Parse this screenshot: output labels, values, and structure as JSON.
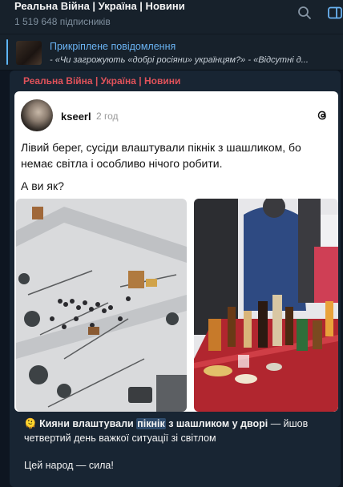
{
  "channel": {
    "title": "Реальна Війна | Україна | Новини",
    "subscribers": "1 519 648 підписників"
  },
  "header_icons": [
    "search-icon",
    "sidebar-toggle-icon"
  ],
  "pinned": {
    "title": "Прикріплене повідомлення",
    "text": "- «Чи загрожують «добрі росіяни» українцям?» - «Відсутні д..."
  },
  "message": {
    "author": "Реальна Війна | Україна | Новини",
    "embed": {
      "username": "kseerl",
      "time": "2 год",
      "text": "Лівий берег, сусіди влаштували пікнік з шашликом, бо немає світла і особливо нічого робити.",
      "question": "А ви як?"
    },
    "caption": {
      "emoji": "🫠",
      "bold_part1": "Кияни влаштували ",
      "highlight": "пікнік",
      "bold_part2": " з шашликом у дворі",
      "rest": " — йшов четвертий день важкої ситуації зі світлом",
      "line2": "Цей народ — сила!"
    }
  },
  "colors": {
    "background": "#0e1621",
    "header": "#17212b",
    "bubble": "#182533",
    "author": "#e0525a",
    "link": "#6ab3f3"
  }
}
